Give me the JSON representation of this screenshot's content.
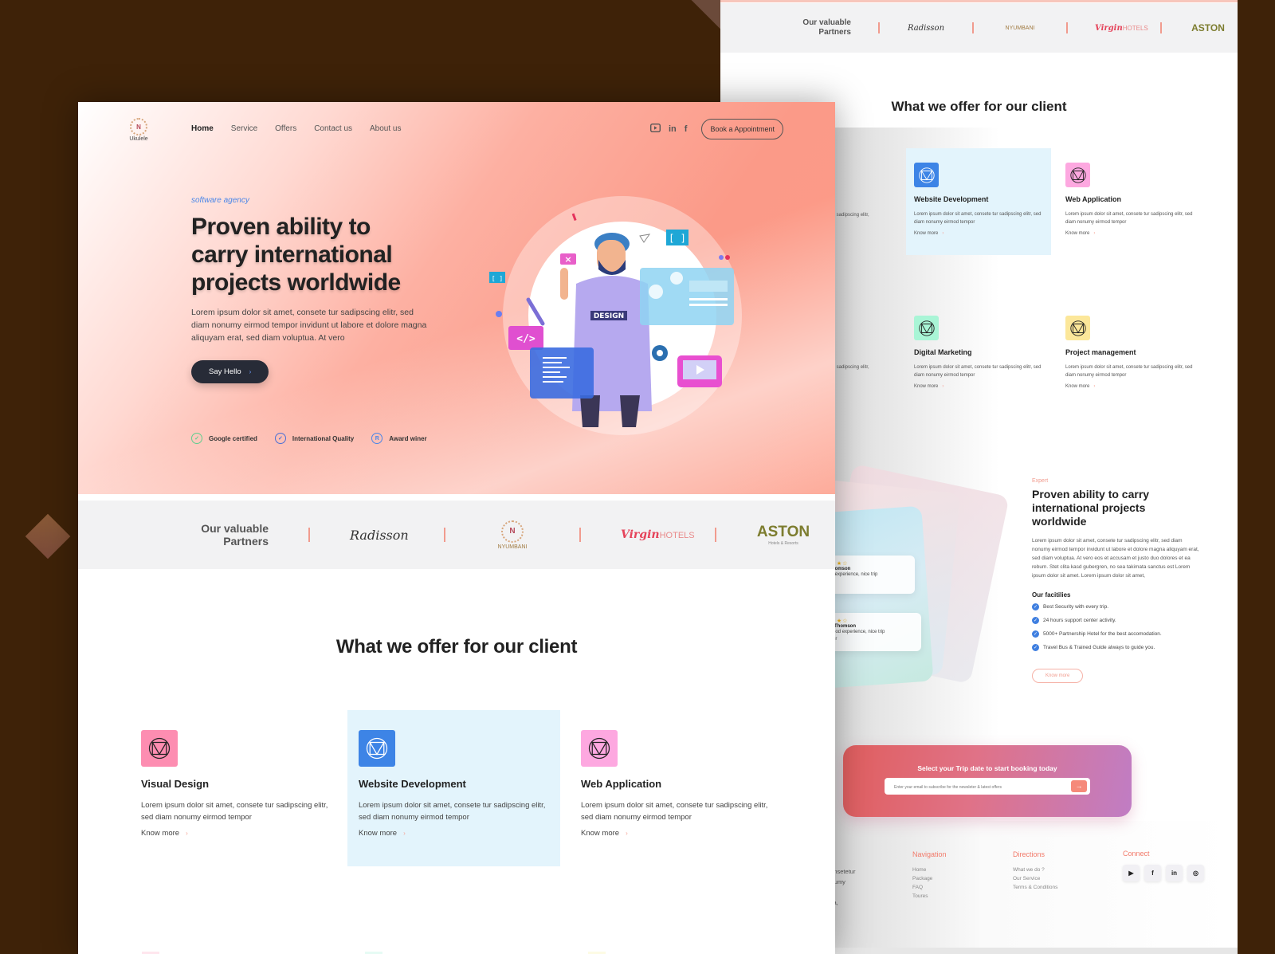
{
  "front": {
    "logo": {
      "mark": "N",
      "name": "Ukulele"
    },
    "nav": [
      {
        "label": "Home",
        "active": true
      },
      {
        "label": "Service"
      },
      {
        "label": "Offers"
      },
      {
        "label": "Contact us"
      },
      {
        "label": "About us"
      }
    ],
    "social_icons": [
      "youtube-icon",
      "linkedin-icon",
      "facebook-icon"
    ],
    "social_glyphs": {
      "youtube": "▶",
      "linkedin": "in",
      "facebook": "f"
    },
    "book_button": "Book a Appointment",
    "hero": {
      "subtitle": "software agency",
      "title": "Proven ability to carry international projects worldwide",
      "text": "Lorem ipsum dolor sit amet, consete tur sadipscing elitr, sed diam nonumy eirmod tempor invidunt ut labore et dolore magna aliquyam erat, sed diam voluptua. At vero",
      "cta": "Say Hello",
      "cta_arrow": "›",
      "illustration_label": "DESIGN"
    },
    "badges": [
      {
        "label": "Google certified",
        "glyph": "✓",
        "color": "#5fcf8e"
      },
      {
        "label": "International Quality",
        "glyph": "✓",
        "color": "#4a6fd6"
      },
      {
        "label": "Award winer",
        "glyph": "R",
        "color": "#4a86e8"
      }
    ],
    "partners": {
      "title_line1": "Our valuable",
      "title_line2": "Partners",
      "logos": [
        {
          "name": "Radisson"
        },
        {
          "name": "NYUMBANI",
          "mark": "N"
        },
        {
          "name": "Virgin",
          "sub": "HOTELS"
        },
        {
          "name": "ASTON",
          "sub": "Hotels & Resorts"
        }
      ]
    },
    "offer_title": "What we offer for our client",
    "services": [
      {
        "title": "Visual Design",
        "desc": "Lorem ipsum dolor sit amet, consete tur sadipscing elitr, sed diam nonumy eirmod tempor",
        "more": "Know more",
        "icon_bg": "#fd8db1",
        "highlighted": false
      },
      {
        "title": "Website Development",
        "desc": "Lorem ipsum dolor sit amet, consete tur sadipscing elitr, sed diam nonumy eirmod tempor",
        "more": "Know more",
        "icon_bg": "#3d84e6",
        "highlighted": true
      },
      {
        "title": "Web Application",
        "desc": "Lorem ipsum dolor sit amet, consete tur sadipscing elitr, sed diam nonumy eirmod tempor",
        "more": "Know more",
        "icon_bg": "#fda8e0",
        "highlighted": false
      }
    ]
  },
  "back": {
    "partners": {
      "title_line1": "Our valuable",
      "title_line2": "Partners",
      "logos": [
        "Radisson",
        "NYUMBANI",
        "Virgin",
        "ASTON"
      ],
      "virgin_sub": "HOTELS"
    },
    "offer_title": "What we offer for our client",
    "cut_text": {
      "line1": "sete tur sadipscing elitr,",
      "line2": "r"
    },
    "services": [
      {
        "title": "Website Development",
        "desc": "Lorem ipsum dolor sit amet, consete tur sadipscing elitr, sed diam nonumy eirmod tempor",
        "more": "Know more",
        "icon_bg": "#3d84e6"
      },
      {
        "title": "Web Application",
        "desc": "Lorem ipsum dolor sit amet, consete tur sadipscing elitr, sed diam nonumy eirmod tempor",
        "more": "Know more",
        "icon_bg": "#fda8e0"
      },
      {
        "title": "Digital Marketing",
        "desc": "Lorem ipsum dolor sit amet, consete tur sadipscing elitr, sed diam nonumy eirmod tempor",
        "more": "Know more",
        "icon_bg": "#a9f5d6"
      },
      {
        "title": "Project management",
        "desc": "Lorem ipsum dolor sit amet, consete tur sadipscing elitr, sed diam nonumy eirmod tempor",
        "more": "Know more",
        "icon_bg": "#fce79a"
      }
    ],
    "reviews": [
      {
        "stars": "★★★★☆",
        "name": "nny Thomson",
        "text_line1": "y good experience,  nice trip",
        "text_line2": "vider"
      },
      {
        "stars": "★★★★☆",
        "name": "Jenny Thomson",
        "text_line1": "Very good experience,  nice trip",
        "text_line2": "Provider"
      }
    ],
    "expert": {
      "tag": "Expert",
      "title": "Proven ability to carry international projects worldwide",
      "text": "Lorem ipsum dolor sit amet, consete tur sadipscing elitr, sed diam nonumy eirmod tempor invidunt ut labore et dolore magna aliquyam erat, sed diam voluptua. At vero eos et accusam et justo duo dolores et ea rebum. Stet clita kasd gubergren, no sea takimata sanctus est Lorem ipsum dolor sit amet. Lorem ipsum dolor sit amet,",
      "facilities_title": "Our facitilies",
      "facilities": [
        "Best Security with every trip.",
        "24 hours support center activity.",
        "5000+ Partnership Hotel for the best accomodation.",
        "Travel Bus & Trained Guide always to guide you."
      ],
      "more": "Know more"
    },
    "booking": {
      "title": "Select your Trip date to start booking today",
      "placeholder": "Enter your email to subscribe for the newsleter & latest offers",
      "arrow": "→"
    },
    "footer": {
      "cut_lines": [
        "et, consetetur",
        "n nonumy",
        "",
        "rapara,"
      ],
      "navigation": {
        "title": "Navigation",
        "links": [
          "Home",
          "Package",
          "FAQ",
          "Toures"
        ]
      },
      "directions": {
        "title": "Directions",
        "links": [
          "What we do ?",
          "Our Service",
          "Terms & Conditions"
        ]
      },
      "connect": {
        "title": "Connect",
        "icons": [
          "youtube-icon",
          "facebook-icon",
          "linkedin-icon",
          "instagram-icon"
        ],
        "glyphs": [
          "▶",
          "f",
          "in",
          "◎"
        ]
      }
    }
  }
}
